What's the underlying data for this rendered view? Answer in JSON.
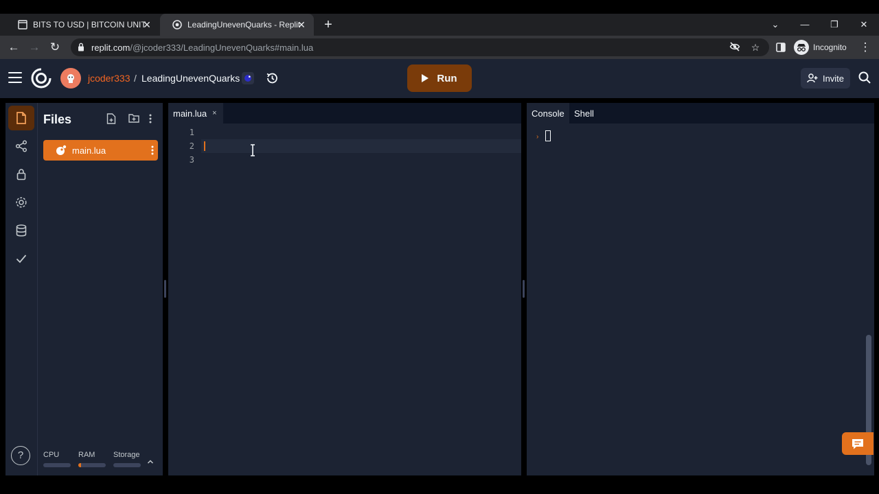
{
  "browser": {
    "tabs": [
      {
        "title": "BITS TO USD | BITCOIN UNITS CO",
        "favicon": "page-icon"
      },
      {
        "title": "LeadingUnevenQuarks - Replit",
        "favicon": "replit-icon"
      }
    ],
    "url_host": "replit.com",
    "url_path": "/@jcoder333/LeadingUnevenQuarks#main.lua",
    "profile_label": "Incognito"
  },
  "header": {
    "username": "jcoder333",
    "separator": "/",
    "repl_name": "LeadingUnevenQuarks",
    "run_label": "Run",
    "invite_label": "Invite"
  },
  "files": {
    "title": "Files",
    "items": [
      {
        "name": "main.lua",
        "icon": "lua-icon"
      }
    ],
    "resources": [
      {
        "label": "CPU",
        "level": 0
      },
      {
        "label": "RAM",
        "level": 0.1
      },
      {
        "label": "Storage",
        "level": 0
      }
    ]
  },
  "editor": {
    "tab_label": "main.lua",
    "tab_close": "×",
    "line_numbers": [
      "1",
      "2",
      "3"
    ]
  },
  "console": {
    "tabs": [
      "Console",
      "Shell"
    ],
    "prompt": "›"
  },
  "help_label": "?",
  "colors": {
    "accent": "#e2711d",
    "run_button": "#7a3b0a",
    "background": "#1c2333",
    "deep_background": "#0e1525"
  }
}
